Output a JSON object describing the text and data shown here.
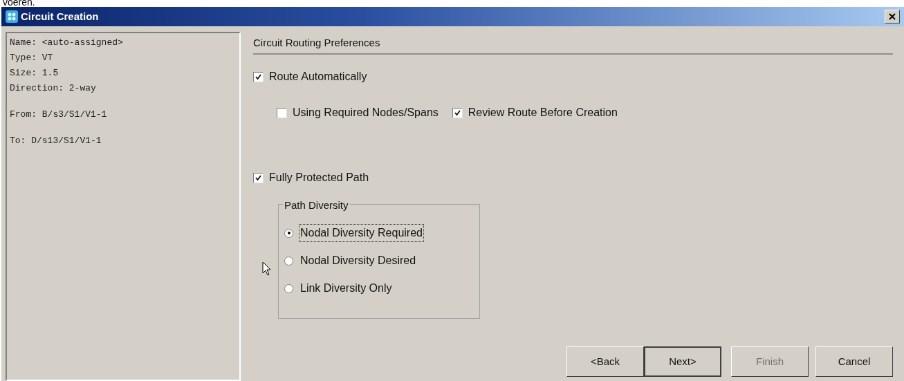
{
  "page_text": "voeren.",
  "window": {
    "title": "Circuit Creation"
  },
  "summary": [
    [
      "Name: <auto-assigned>",
      "Type: VT",
      "Size: 1.5",
      "Direction: 2-way"
    ],
    [
      "From: B/s3/S1/V1-1"
    ],
    [
      "To: D/s13/S1/V1-1"
    ]
  ],
  "section": {
    "title": "Circuit Routing Preferences",
    "route_automatically": {
      "label": "Route Automatically",
      "checked": true
    },
    "sub_options": [
      {
        "label": "Using Required Nodes/Spans",
        "checked": false
      },
      {
        "label": "Review Route Before Creation",
        "checked": true
      }
    ],
    "fully_protected": {
      "label": "Fully Protected Path",
      "checked": true
    },
    "path_diversity": {
      "title": "Path Diversity",
      "options": [
        {
          "label": "Nodal Diversity Required",
          "selected": true,
          "focused": true
        },
        {
          "label": "Nodal Diversity Desired",
          "selected": false,
          "focused": false
        },
        {
          "label": "Link Diversity Only",
          "selected": false,
          "focused": false
        }
      ]
    }
  },
  "buttons": [
    {
      "label": "<Back",
      "disabled": false,
      "default": false
    },
    {
      "label": "Next>",
      "disabled": false,
      "default": true
    },
    {
      "label": "Finish",
      "disabled": true,
      "default": false
    },
    {
      "label": "Cancel",
      "disabled": false,
      "default": false
    }
  ]
}
